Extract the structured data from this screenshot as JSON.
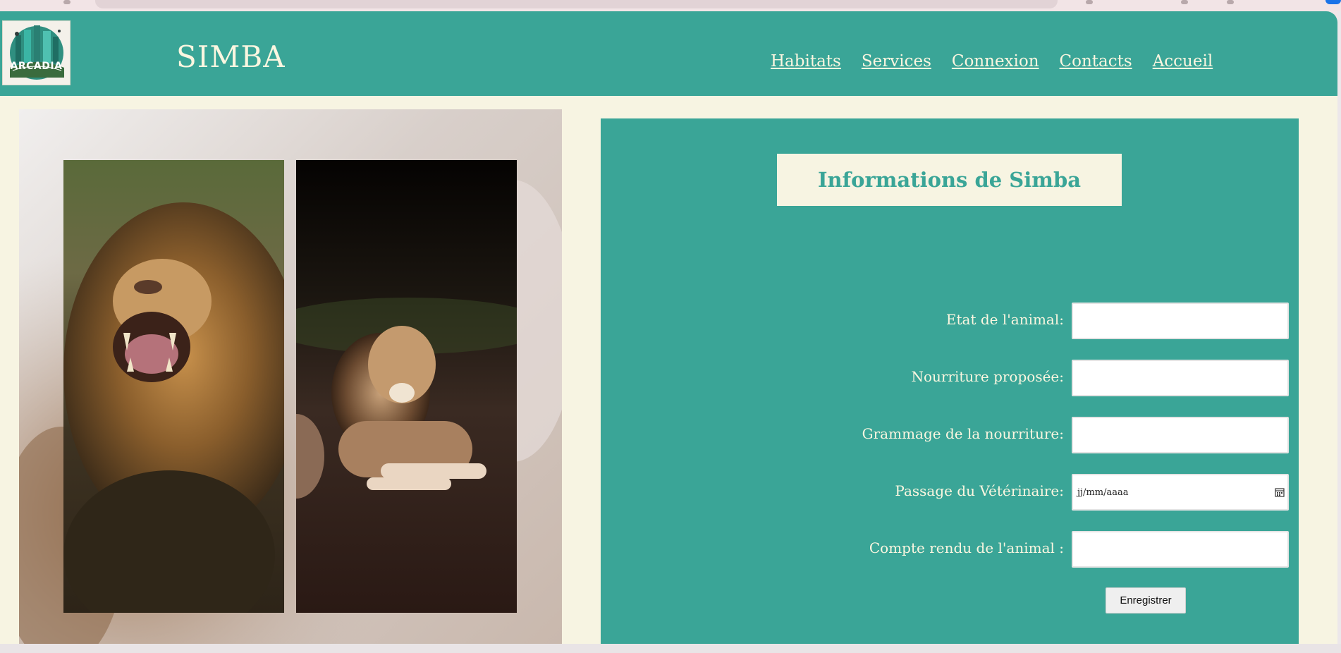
{
  "header": {
    "logo_text": "ARCADIA",
    "title": "SIMBA",
    "nav": [
      "Habitats",
      "Services",
      "Connexion",
      "Contacts",
      "Accueil"
    ]
  },
  "info": {
    "title": "Informations de Simba",
    "fields": [
      {
        "label": "Etat de l'animal:",
        "value": ""
      },
      {
        "label": "Nourriture proposée:",
        "value": ""
      },
      {
        "label": "Grammage de la nourriture:",
        "value": ""
      },
      {
        "label": "Passage du Vétérinaire:",
        "value": "",
        "placeholder": "jj/mm/aaaa"
      },
      {
        "label": "Compte rendu de l'animal :",
        "value": ""
      }
    ],
    "save_label": "Enregistrer"
  },
  "colors": {
    "header_bg": "#3aa597",
    "page_bg": "#f7f4e2",
    "text_light": "#fbf6e0"
  },
  "icons": [
    "calendar-icon"
  ]
}
